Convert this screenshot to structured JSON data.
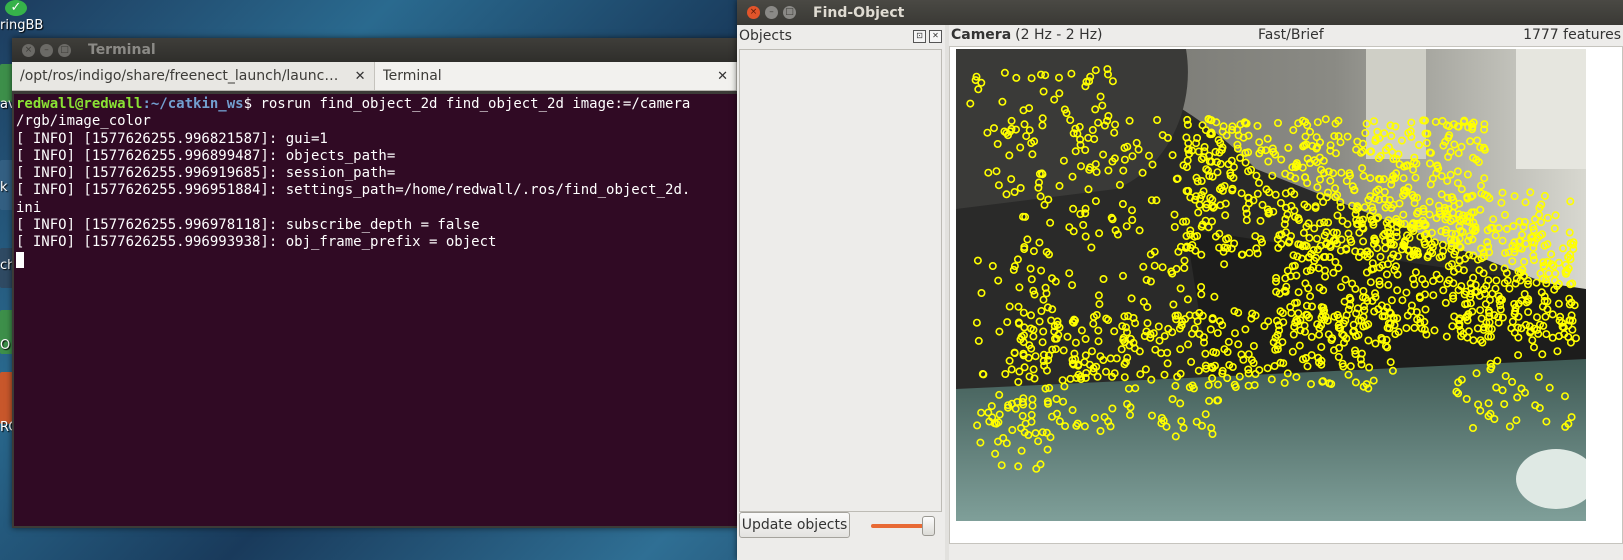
{
  "desktop": {
    "icon_labels": [
      "ringBB",
      "av",
      "k",
      "ch",
      "O",
      "RC"
    ]
  },
  "terminal": {
    "window_title": "Terminal",
    "tabs": [
      {
        "label": "/opt/ros/indigo/share/freenect_launch/launc…",
        "close": "✕"
      },
      {
        "label": "Terminal",
        "close": "✕"
      }
    ],
    "prompt_user": "redwall@redwall",
    "prompt_path": ":~/catkin_ws",
    "prompt_symbol": "$ ",
    "command": "rosrun find_object_2d find_object_2d image:=/camera",
    "command_wrap": "/rgb/image_color",
    "output_lines": [
      "[ INFO] [1577626255.996821587]: gui=1",
      "[ INFO] [1577626255.996899487]: objects_path=",
      "[ INFO] [1577626255.996919685]: session_path=",
      "[ INFO] [1577626255.996951884]: settings_path=/home/redwall/.ros/find_object_2d.",
      "ini",
      "[ INFO] [1577626255.996978118]: subscribe_depth = false",
      "[ INFO] [1577626255.996993938]: obj_frame_prefix = object"
    ],
    "colors": {
      "background": "#300a24",
      "prompt_user": "#8ae234",
      "prompt_path": "#729fcf"
    }
  },
  "find_object": {
    "window_title": "Find-Object",
    "objects_panel": {
      "title": "Objects",
      "float_glyph": "⊡",
      "close_glyph": "✕",
      "update_button": "Update objects",
      "slider_value": 100
    },
    "camera_panel": {
      "title": "Camera",
      "rate": "(2 Hz - 2 Hz)",
      "detector": "Fast/Brief",
      "features": "1777 features"
    },
    "feature_color": "#ffff00"
  },
  "icons": {
    "close": "×",
    "minimize": "–",
    "maximize": "□",
    "check": "✓"
  }
}
